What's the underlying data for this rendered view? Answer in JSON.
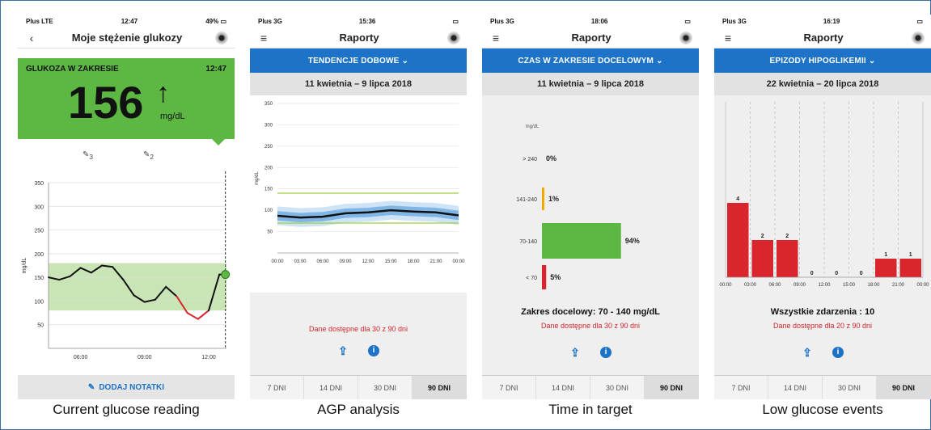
{
  "captions": [
    "Current glucose reading",
    "AGP analysis",
    "Time in target",
    "Low glucose events"
  ],
  "phone1": {
    "status": {
      "carrier": "Plus LTE",
      "time": "12:47",
      "battery": "49%"
    },
    "title": "Moje stężenie glukozy",
    "banner": {
      "label": "GLUKOZA W ZAKRESIE",
      "time": "12:47",
      "value": "156",
      "unit": "mg/dL",
      "color": "#5cb843"
    },
    "markers": [
      "3",
      "2"
    ],
    "y_ticks": [
      "350",
      "300",
      "250",
      "200",
      "150",
      "100",
      "50"
    ],
    "x_ticks": [
      "06:00",
      "09:00",
      "12:00"
    ],
    "y_label": "mg/dL",
    "note_button": "DODAJ NOTATKI"
  },
  "phone2": {
    "status": {
      "carrier": "Plus 3G",
      "time": "15:36"
    },
    "title": "Raporty",
    "dropdown": "TENDENCJE DOBOWE",
    "date_range": "11 kwietnia – 9 lipca 2018",
    "y_ticks": [
      "350",
      "300",
      "250",
      "200",
      "150",
      "100",
      "50"
    ],
    "x_ticks": [
      "00:00",
      "03:00",
      "06:00",
      "09:00",
      "12:00",
      "15:00",
      "18:00",
      "21:00",
      "00:00"
    ],
    "y_label": "mg/dL",
    "availability": "Dane dostępne dla 30 z 90 dni",
    "tabs": [
      "7 DNI",
      "14 DNI",
      "30 DNI",
      "90 DNI"
    ]
  },
  "phone3": {
    "status": {
      "carrier": "Plus 3G",
      "time": "18:06"
    },
    "title": "Raporty",
    "dropdown": "CZAS W ZAKRESIE DOCELOWYM",
    "date_range": "11 kwietnia – 9 lipca 2018",
    "unit_label": "mg/dL",
    "rows": [
      {
        "range": "> 240",
        "pct": "0%",
        "value": 0,
        "color": "#f2a900"
      },
      {
        "range": "141-240",
        "pct": "1%",
        "value": 1,
        "color": "#f2a900"
      },
      {
        "range": "70-140",
        "pct": "94%",
        "value": 94,
        "color": "#5cb843"
      },
      {
        "range": "< 70",
        "pct": "5%",
        "value": 5,
        "color": "#d9262c"
      }
    ],
    "target_text": "Zakres docelowy: 70 - 140 mg/dL",
    "availability": "Dane dostępne dla 30 z 90 dni",
    "tabs": [
      "7 DNI",
      "14 DNI",
      "30 DNI",
      "90 DNI"
    ]
  },
  "phone4": {
    "status": {
      "carrier": "Plus 3G",
      "time": "16:19"
    },
    "title": "Raporty",
    "dropdown": "EPIZODY HIPOGLIKEMII",
    "date_range": "22 kwietnia – 20 lipca 2018",
    "x_ticks": [
      "00:00",
      "03:00",
      "06:00",
      "09:00",
      "12:00",
      "15:00",
      "18:00",
      "21:00",
      "00:00"
    ],
    "total_text": "Wszystkie zdarzenia : 10",
    "availability": "Dane dostępne dla 20 z 90 dni",
    "tabs": [
      "7 DNI",
      "14 DNI",
      "30 DNI",
      "90 DNI"
    ]
  },
  "chart_data": [
    {
      "type": "line",
      "x": [
        "04:30",
        "05:00",
        "05:30",
        "06:00",
        "06:30",
        "07:00",
        "07:30",
        "08:00",
        "08:30",
        "09:00",
        "09:30",
        "10:00",
        "10:30",
        "11:00",
        "11:30",
        "12:00",
        "12:30",
        "12:47"
      ],
      "values": [
        150,
        145,
        152,
        170,
        160,
        175,
        172,
        145,
        112,
        98,
        103,
        130,
        110,
        75,
        62,
        80,
        156,
        156
      ],
      "ylim": [
        0,
        350
      ],
      "target_band": [
        80,
        180
      ]
    },
    {
      "type": "line",
      "x": [
        "00:00",
        "03:00",
        "06:00",
        "09:00",
        "12:00",
        "15:00",
        "18:00",
        "21:00",
        "00:00"
      ],
      "series": [
        {
          "values": [
            87,
            83,
            85,
            93,
            95,
            100,
            97,
            95,
            88
          ]
        }
      ],
      "target_band": [
        70,
        140
      ],
      "ylim": [
        0,
        350
      ]
    },
    {
      "type": "bar",
      "categories": [
        "> 240",
        "141-240",
        "70-140",
        "< 70"
      ],
      "values": [
        0,
        1,
        94,
        5
      ]
    },
    {
      "type": "bar",
      "categories": [
        "00:00",
        "03:00",
        "06:00",
        "09:00",
        "12:00",
        "15:00",
        "18:00",
        "21:00"
      ],
      "values": [
        4,
        2,
        2,
        0,
        0,
        0,
        1,
        1
      ]
    }
  ]
}
